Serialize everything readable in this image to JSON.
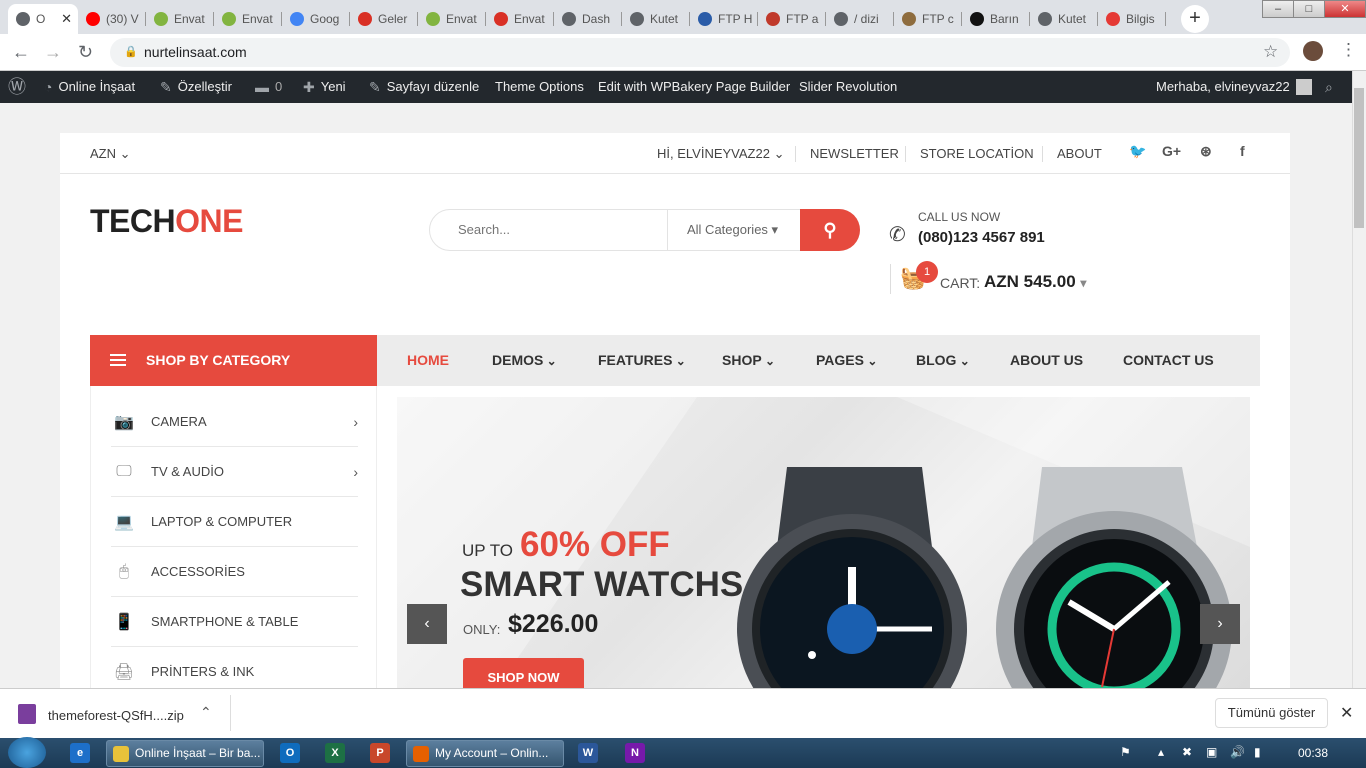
{
  "browser": {
    "tabs": [
      {
        "label": "O",
        "icon": "chrome-icon",
        "color": "#5f6368",
        "active": true
      },
      {
        "label": "(30) V",
        "icon": "youtube-icon",
        "color": "#ff0000"
      },
      {
        "label": "Envat",
        "icon": "envato-icon",
        "color": "#82b440"
      },
      {
        "label": "Envat",
        "icon": "envato-icon",
        "color": "#82b440"
      },
      {
        "label": "Goog",
        "icon": "google-translate-icon",
        "color": "#4285f4"
      },
      {
        "label": "Geler",
        "icon": "gmail-icon",
        "color": "#d93025"
      },
      {
        "label": "Envat",
        "icon": "envato-icon",
        "color": "#82b440"
      },
      {
        "label": "Envat",
        "icon": "gmail-icon",
        "color": "#d93025"
      },
      {
        "label": "Dash",
        "icon": "globe-icon",
        "color": "#5f6368"
      },
      {
        "label": "Kutet",
        "icon": "globe-icon",
        "color": "#5f6368"
      },
      {
        "label": "FTP H",
        "icon": "ftp-icon",
        "color": "#2a5ca8"
      },
      {
        "label": "FTP a",
        "icon": "ftp-icon",
        "color": "#c0392b"
      },
      {
        "label": "/ dizi",
        "icon": "globe-icon",
        "color": "#5f6368"
      },
      {
        "label": "FTP c",
        "icon": "ftp-icon",
        "color": "#8e6c3e"
      },
      {
        "label": "Barın",
        "icon": "g-icon",
        "color": "#111111"
      },
      {
        "label": "Kutet",
        "icon": "globe-icon",
        "color": "#5f6368"
      },
      {
        "label": "Bilgis",
        "icon": "h-icon",
        "color": "#e53935"
      }
    ],
    "url": "nurtelinsaat.com"
  },
  "wpbar": {
    "site": "Online İnşaat",
    "customize": "Özelleştir",
    "comments": "0",
    "new": "Yeni",
    "edit": "Sayfayı düzenle",
    "theme_options": "Theme Options",
    "wpbakery": "Edit with WPBakery Page Builder",
    "slider": "Slider Revolution",
    "greeting": "Merhaba, elvineyvaz22"
  },
  "topbar": {
    "currency": "AZN",
    "user": "Hİ, ELVİNEYVAZ22",
    "newsletter": "NEWSLETTER",
    "store": "STORE LOCATİON",
    "about": "ABOUT"
  },
  "logo": {
    "part1": "TECH",
    "part2": "ONE"
  },
  "search": {
    "placeholder": "Search...",
    "category": "All Categories"
  },
  "contact": {
    "label": "CALL US NOW",
    "phone": "(080)123 4567 891"
  },
  "cart": {
    "count": "1",
    "label": "CART:",
    "amount": "AZN 545.00"
  },
  "shop_by_category": "SHOP BY CATEGORY",
  "nav": [
    {
      "label": "HOME",
      "active": true
    },
    {
      "label": "DEMOS",
      "dropdown": true
    },
    {
      "label": "FEATURES",
      "dropdown": true
    },
    {
      "label": "SHOP",
      "dropdown": true
    },
    {
      "label": "PAGES",
      "dropdown": true
    },
    {
      "label": "BLOG",
      "dropdown": true
    },
    {
      "label": "ABOUT US"
    },
    {
      "label": "CONTACT US"
    }
  ],
  "categories": [
    {
      "label": "CAMERA",
      "icon": "camera-icon",
      "arrow": true
    },
    {
      "label": "TV & AUDİO",
      "icon": "tv-icon",
      "arrow": true
    },
    {
      "label": "LAPTOP & COMPUTER",
      "icon": "laptop-icon"
    },
    {
      "label": "ACCESSORİES",
      "icon": "mouse-icon"
    },
    {
      "label": "SMARTPHONE & TABLE",
      "icon": "smartphone-icon"
    },
    {
      "label": "PRİNTERS & INK",
      "icon": "printer-icon"
    }
  ],
  "slide": {
    "up_to": "UP TO",
    "discount": "60% OFF",
    "title": "SMART WATCHS",
    "only": "ONLY:",
    "price": "$226.00",
    "button": "SHOP NOW"
  },
  "download": {
    "file": "themeforest-QSfH....zip",
    "show_all": "Tümünü göster"
  },
  "taskbar": {
    "chrome_window": "Online İnşaat – Bir ba...",
    "firefox_window": "My Account – Onlin...",
    "time": "00:38"
  },
  "colors": {
    "accent": "#e64a3e",
    "dark": "#23282d"
  }
}
